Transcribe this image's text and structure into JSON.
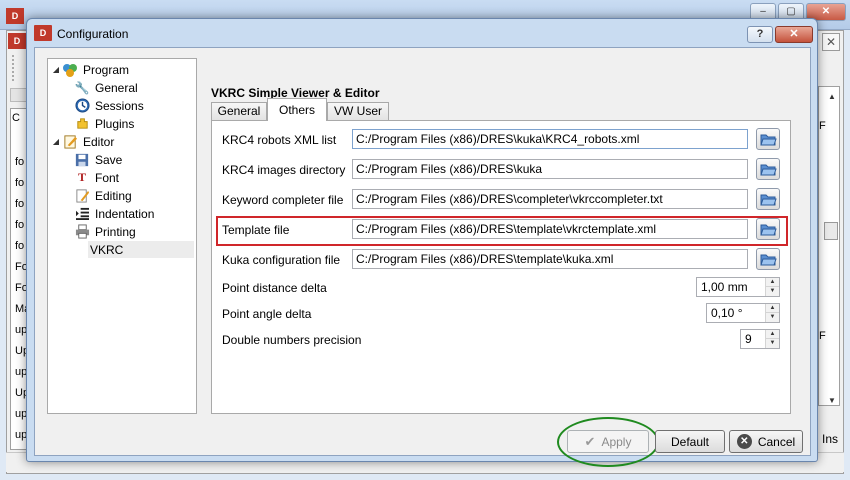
{
  "background_app": {
    "ins_label": "Ins",
    "tab_label": "C",
    "list_rows": [
      "fo",
      "fo",
      "fo",
      "fo",
      "fo",
      "Fo",
      "Fo",
      "Ma",
      "up",
      "Up",
      "up",
      "Up",
      "up",
      "up"
    ],
    "right_markers": [
      "F",
      "F"
    ]
  },
  "dialog": {
    "title": "Configuration",
    "help_label": "?",
    "close_label": "✕"
  },
  "tree": {
    "items": [
      {
        "label": "Program",
        "icon": "program-icon",
        "expander": "◢"
      },
      {
        "label": "General",
        "icon": "wrench-icon"
      },
      {
        "label": "Sessions",
        "icon": "clock-icon"
      },
      {
        "label": "Plugins",
        "icon": "plugin-icon"
      },
      {
        "label": "Editor",
        "icon": "editor-icon",
        "expander": "◢"
      },
      {
        "label": "Save",
        "icon": "save-icon"
      },
      {
        "label": "Font",
        "icon": "font-icon"
      },
      {
        "label": "Editing",
        "icon": "pencil-icon"
      },
      {
        "label": "Indentation",
        "icon": "indent-icon"
      },
      {
        "label": "Printing",
        "icon": "printer-icon"
      },
      {
        "label": "VKRC",
        "icon": ""
      }
    ],
    "selected": "VKRC"
  },
  "content": {
    "section_title": "VKRC Simple Viewer & Editor",
    "tabs": [
      "General",
      "Others",
      "VW User"
    ],
    "active_tab": "Others",
    "file_rows": [
      {
        "label": "KRC4 robots XML list",
        "value": "C:/Program Files (x86)/DRES\\kuka\\KRC4_robots.xml"
      },
      {
        "label": "KRC4 images directory",
        "value": "C:/Program Files (x86)/DRES\\kuka"
      },
      {
        "label": "Keyword completer file",
        "value": "C:/Program Files (x86)/DRES\\completer\\vkrccompleter.txt"
      },
      {
        "label": "Template file",
        "value": "C:/Program Files (x86)/DRES\\template\\vkrctemplate.xml"
      },
      {
        "label": "Kuka configuration file",
        "value": "C:/Program Files (x86)/DRES\\template\\kuka.xml"
      }
    ],
    "numeric_rows": [
      {
        "label": "Point distance delta",
        "value": "1,00 mm"
      },
      {
        "label": "Point angle delta",
        "value": "0,10 °"
      },
      {
        "label": "Double numbers precision",
        "value": "9"
      }
    ],
    "highlighted_row": "Template file"
  },
  "buttons": {
    "apply": "Apply",
    "default": "Default",
    "cancel": "Cancel"
  },
  "colors": {
    "highlight_box": "#d0262a",
    "apply_circle": "#1f8a1f",
    "title_bar": "#c9dcf1"
  }
}
